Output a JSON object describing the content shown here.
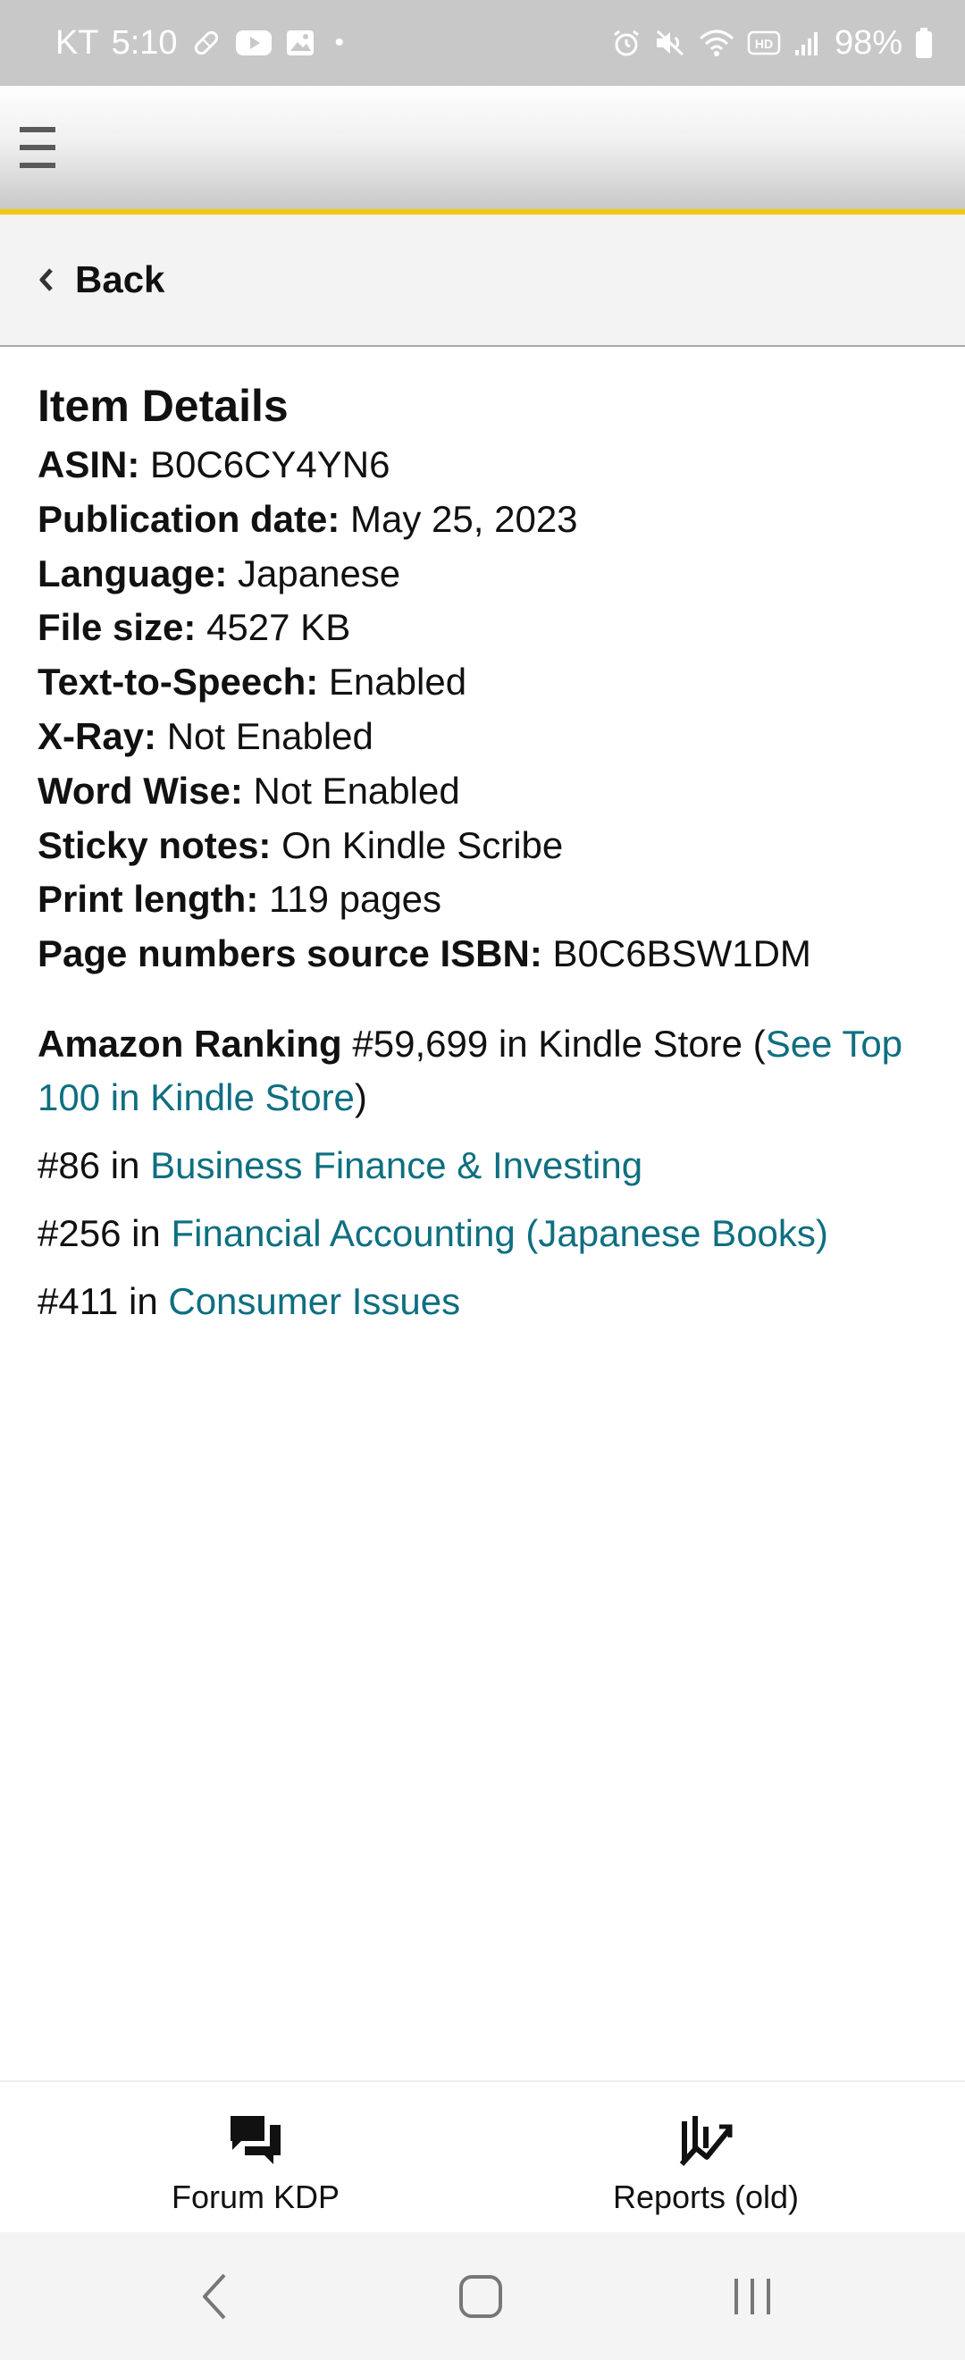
{
  "status_bar": {
    "carrier": "KT",
    "time": "5:10",
    "dot": "•",
    "battery": "98%",
    "icons": [
      "bandage-icon",
      "youtube-icon",
      "image-icon",
      "alarm-icon",
      "mute-icon",
      "wifi-icon",
      "hd-icon",
      "signal-icon",
      "battery-icon"
    ]
  },
  "header": {
    "menu_icon": "hamburger-menu-icon",
    "accent_color": "#f2c811"
  },
  "back": {
    "label": "Back"
  },
  "item_details": {
    "title": "Item Details",
    "rows": [
      {
        "label": "ASIN:",
        "value": "B0C6CY4YN6"
      },
      {
        "label": "Publication date:",
        "value": "May 25, 2023"
      },
      {
        "label": "Language:",
        "value": "Japanese"
      },
      {
        "label": "File size:",
        "value": "4527 KB"
      },
      {
        "label": "Text-to-Speech:",
        "value": "Enabled"
      },
      {
        "label": "X-Ray:",
        "value": "Not Enabled"
      },
      {
        "label": "Word Wise:",
        "value": "Not Enabled"
      },
      {
        "label": "Sticky notes:",
        "value": "On Kindle Scribe"
      },
      {
        "label": "Print length:",
        "value": "119 pages"
      },
      {
        "label": "Page numbers source ISBN:",
        "value": "B0C6BSW1DM"
      }
    ]
  },
  "ranking": {
    "title": "Amazon Ranking",
    "main_text": "#59,699 in Kindle Store (",
    "main_link": "See Top 100 in Kindle Store",
    "main_close": ")",
    "link_color": "#0e6f80",
    "categories": [
      {
        "rank": "#86 in",
        "name": "Business Finance & Investing"
      },
      {
        "rank": "#256 in",
        "name": "Financial Accounting (Japanese Books)"
      },
      {
        "rank": "#411 in",
        "name": "Consumer Issues"
      }
    ]
  },
  "bottom_nav": {
    "items": [
      {
        "label": "Forum KDP",
        "icon": "forum-chat-icon"
      },
      {
        "label": "Reports (old)",
        "icon": "reports-chart-icon"
      }
    ]
  },
  "system_nav": {
    "buttons": [
      "back-nav-icon",
      "home-nav-icon",
      "recents-nav-icon"
    ]
  }
}
